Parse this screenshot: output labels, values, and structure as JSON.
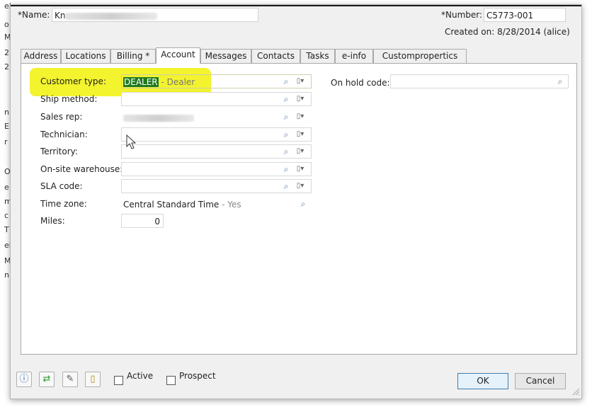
{
  "background_fragments": [
    "el",
    "o",
    "M",
    "2",
    "2",
    "n",
    "E",
    "r",
    "O",
    "e",
    "m",
    "c",
    "T",
    "el",
    "Mi",
    "n"
  ],
  "header": {
    "name_label": "*Name:",
    "name_value": "Kn",
    "number_label": "*Number:",
    "number_value": "C5773-001",
    "created_on": "Created on: 8/28/2014 (alice)"
  },
  "tabs": [
    "Address",
    "Locations",
    "Billing *",
    "Account",
    "Messages",
    "Contacts",
    "Tasks",
    "e-info",
    "Custompropertics"
  ],
  "active_tab": "Account",
  "fields": {
    "customer_type": {
      "label": "Customer type:",
      "code": "DEALER",
      "desc": " - Dealer"
    },
    "ship_method": {
      "label": "Ship method:"
    },
    "sales_rep": {
      "label": "Sales rep:"
    },
    "technician": {
      "label": "Technician:"
    },
    "territory": {
      "label": "Territory:"
    },
    "onsite_warehouse": {
      "label": "On-site warehouse:"
    },
    "sla_code": {
      "label": "SLA code:"
    },
    "time_zone": {
      "label": "Time zone:",
      "value": "Central Standard Time",
      "desc": " - Yes"
    },
    "miles": {
      "label": "Miles:",
      "value": "0"
    },
    "on_hold_code": {
      "label": "On hold code:"
    }
  },
  "footer": {
    "active_label": "Active",
    "prospect_label": "Prospect",
    "ok_label": "OK",
    "cancel_label": "Cancel"
  },
  "colors": {
    "highlight": "#f2f217",
    "selection": "#1f7a1f",
    "required": "#d43030",
    "ok_border": "#3c7fb1"
  }
}
